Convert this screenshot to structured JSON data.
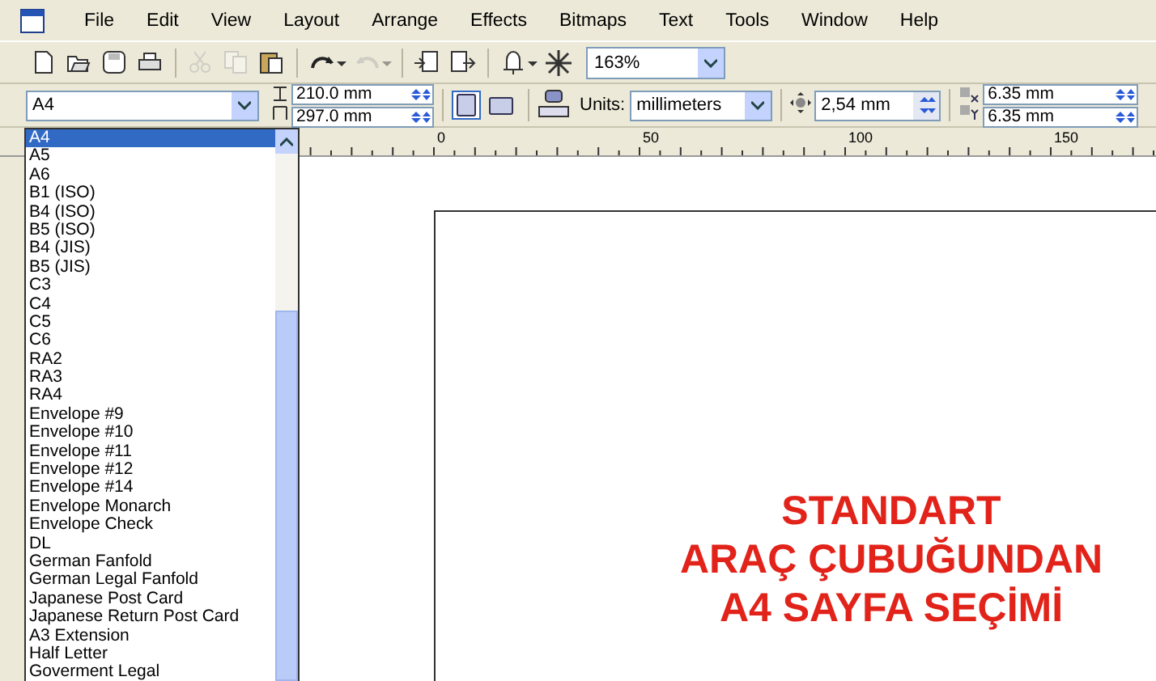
{
  "menu_bar": {
    "items": [
      "File",
      "Edit",
      "View",
      "Layout",
      "Arrange",
      "Effects",
      "Bitmaps",
      "Text",
      "Tools",
      "Window",
      "Help"
    ]
  },
  "standard_toolbar": {
    "tools": [
      {
        "kind": "new",
        "disabled": false
      },
      {
        "kind": "open",
        "disabled": false
      },
      {
        "kind": "save",
        "disabled": false
      },
      {
        "kind": "print",
        "disabled": false
      },
      {
        "kind": "cut",
        "disabled": true
      },
      {
        "kind": "copy",
        "disabled": true
      },
      {
        "kind": "paste",
        "disabled": false
      },
      {
        "kind": "undo",
        "disabled": false
      },
      {
        "kind": "redo",
        "disabled": true
      },
      {
        "kind": "import",
        "disabled": false
      },
      {
        "kind": "export",
        "disabled": false
      },
      {
        "kind": "launcher",
        "disabled": false
      },
      {
        "kind": "connect",
        "disabled": false
      }
    ],
    "zoom": "163%"
  },
  "property_bar": {
    "paper_size": "A4",
    "width": "210.0 mm",
    "height": "297.0 mm",
    "orientation": [
      {
        "kind": "portrait",
        "selected": true
      },
      {
        "kind": "landscape",
        "selected": false
      }
    ],
    "units_label": "Units:",
    "units": "millimeters",
    "nudge": "2,54 mm",
    "duplicate_x": "6.35 mm",
    "duplicate_y": "6.35 mm"
  },
  "paper_list": {
    "items": [
      {
        "label": "A4",
        "selected": true
      },
      {
        "label": "A5",
        "selected": false
      },
      {
        "label": "A6",
        "selected": false
      },
      {
        "label": "B1 (ISO)",
        "selected": false
      },
      {
        "label": "B4 (ISO)",
        "selected": false
      },
      {
        "label": "B5 (ISO)",
        "selected": false
      },
      {
        "label": "B4 (JIS)",
        "selected": false
      },
      {
        "label": "B5 (JIS)",
        "selected": false
      },
      {
        "label": "C3",
        "selected": false
      },
      {
        "label": "C4",
        "selected": false
      },
      {
        "label": "C5",
        "selected": false
      },
      {
        "label": "C6",
        "selected": false
      },
      {
        "label": "RA2",
        "selected": false
      },
      {
        "label": "RA3",
        "selected": false
      },
      {
        "label": "RA4",
        "selected": false
      },
      {
        "label": "Envelope #9",
        "selected": false
      },
      {
        "label": "Envelope #10",
        "selected": false
      },
      {
        "label": "Envelope #11",
        "selected": false
      },
      {
        "label": "Envelope #12",
        "selected": false
      },
      {
        "label": "Envelope #14",
        "selected": false
      },
      {
        "label": "Envelope Monarch",
        "selected": false
      },
      {
        "label": "Envelope Check",
        "selected": false
      },
      {
        "label": "DL",
        "selected": false
      },
      {
        "label": "German Fanfold",
        "selected": false
      },
      {
        "label": "German Legal Fanfold",
        "selected": false
      },
      {
        "label": "Japanese Post Card",
        "selected": false
      },
      {
        "label": "Japanese Return Post Card",
        "selected": false
      },
      {
        "label": "A3 Extension",
        "selected": false
      },
      {
        "label": "Half Letter",
        "selected": false
      },
      {
        "label": "Goverment Legal",
        "selected": false
      }
    ]
  },
  "ruler": {
    "labels": [
      "0",
      "50",
      "100",
      "150"
    ]
  },
  "canvas": {
    "heading_lines": [
      "STANDART",
      "ARAÇ ÇUBUĞUNDAN",
      "A4 SAYFA SEÇİMİ"
    ]
  }
}
